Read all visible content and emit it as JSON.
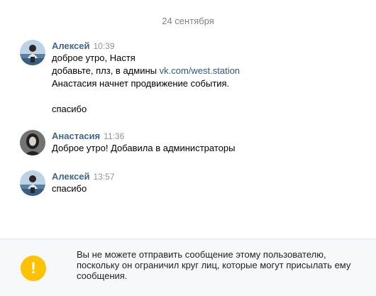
{
  "date_divider": "24 сентября",
  "messages": [
    {
      "author": "Алексей",
      "time": "10:39",
      "avatar_icon": "photo-avatar-aleksey",
      "lines": {
        "l1": "доброе утро, Настя",
        "l2_text": "добавьте, плз, в админы ",
        "l2_link": "vk.com/west.station",
        "l3": "Анастасия начнет продвижение события.",
        "l4": "",
        "l5": "спасибо"
      }
    },
    {
      "author": "Анастасия",
      "time": "11:36",
      "avatar_icon": "photo-avatar-anastasia",
      "lines": {
        "l1": "Доброе утро! Добавила в администраторы"
      }
    },
    {
      "author": "Алексей",
      "time": "13:57",
      "avatar_icon": "photo-avatar-aleksey",
      "lines": {
        "l1": "спасибо"
      }
    }
  ],
  "blocked_notice": {
    "icon": "warning-icon",
    "icon_glyph": "!",
    "text": "Вы не можете отправить сообщение этому пользователю, поскольку он ограничил круг лиц, которые могут присылать ему сообщения.",
    "accent": "#ffc100"
  },
  "colors": {
    "author": "#42648b",
    "link": "#2a5885",
    "muted": "#939393",
    "panel_bg": "#f7f8fa"
  }
}
